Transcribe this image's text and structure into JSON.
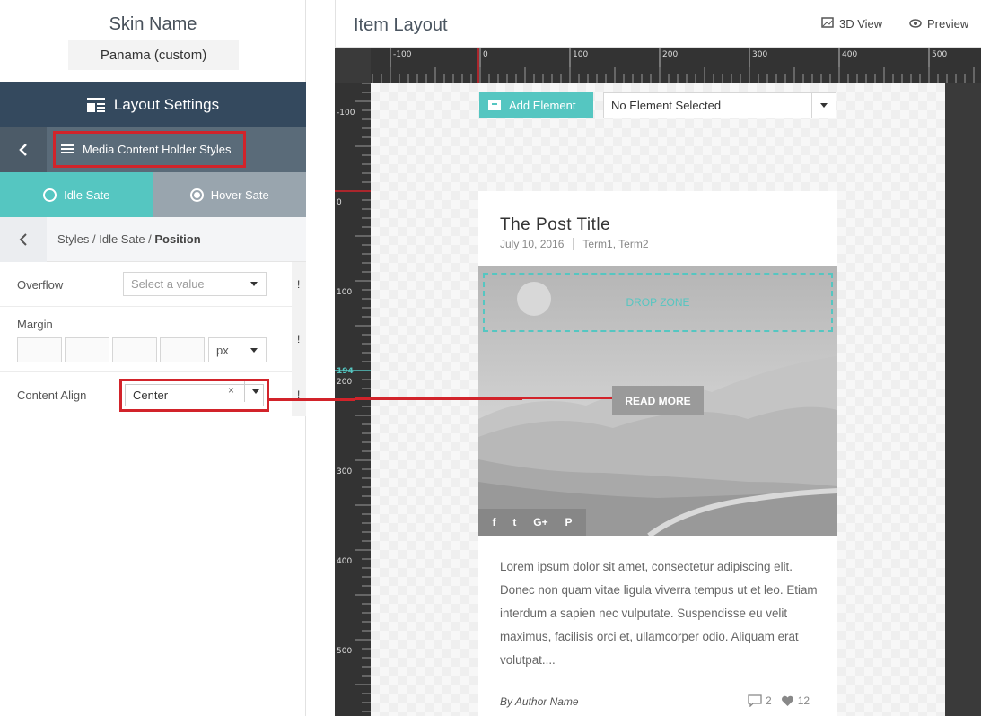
{
  "skin": {
    "title": "Skin Name",
    "value": "Panama (custom)"
  },
  "layout_settings": {
    "label": "Layout Settings",
    "icon": "layout-icon"
  },
  "media_bar": {
    "back_icon": "chevron-left-icon",
    "label": "Media Content Holder Styles",
    "menu_icon": "hamburger-icon"
  },
  "states": {
    "idle": "Idle Sate",
    "hover": "Hover Sate",
    "selected": "idle"
  },
  "breadcrumb": {
    "path": "Styles / Idle Sate / ",
    "current": "Position"
  },
  "fields": {
    "overflow": {
      "label": "Overflow",
      "placeholder": "Select a value"
    },
    "margin": {
      "label": "Margin",
      "unit": "px"
    },
    "content_align": {
      "label": "Content Align",
      "value": "Center",
      "clear": "×"
    },
    "bang": "!"
  },
  "header": {
    "title": "Item Layout",
    "view3d": "3D View",
    "preview": "Preview"
  },
  "ruler": {
    "top": [
      "-100",
      "0",
      "100",
      "200",
      "300",
      "400",
      "500"
    ],
    "left": [
      "-100",
      "0",
      "100",
      "194",
      "200",
      "300",
      "400",
      "500"
    ]
  },
  "toolbar": {
    "add_element": "Add Element",
    "element_select": "No Element Selected"
  },
  "card": {
    "title": "The Post Title",
    "date": "July 10, 2016",
    "terms": "Term1, Term2",
    "drop_zone": "DROP ZONE",
    "read_more": "READ MORE",
    "social": [
      "f",
      "t",
      "G+",
      "P"
    ],
    "excerpt": "Lorem ipsum dolor sit amet, consectetur adipiscing elit. Donec non quam vitae ligula viverra tempus ut et leo. Etiam interdum a sapien nec vulputate. Suspendisse eu velit maximus, facilisis orci et, ullamcorper odio. Aliquam erat volutpat....",
    "author": "By Author Name",
    "comments": "2",
    "likes": "12"
  },
  "colors": {
    "accent": "#55c6c1",
    "dark": "#34495e",
    "highlight": "#d2232a"
  }
}
